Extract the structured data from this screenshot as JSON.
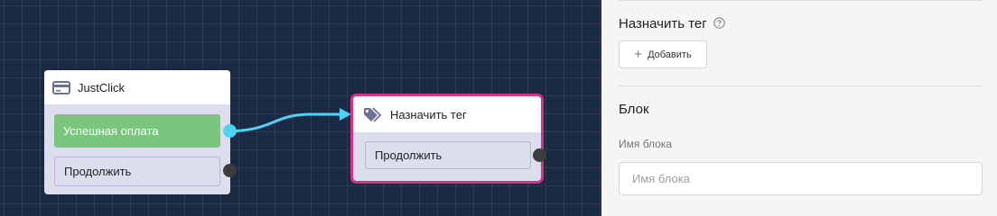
{
  "canvas": {
    "nodes": {
      "justclick": {
        "title": "JustClick",
        "icon": "credit-card-icon",
        "buttons": {
          "success": "Успешная оплата",
          "continue": "Продолжить"
        }
      },
      "assign_tag": {
        "title": "Назначить тег",
        "icon": "tags-icon",
        "buttons": {
          "continue": "Продолжить"
        }
      }
    },
    "colors": {
      "background": "#1b2a44",
      "success": "#7bc67e",
      "connection": "#4fd3f5",
      "selected_border": "#d63384"
    }
  },
  "sidebar": {
    "assign_tag": {
      "title": "Назначить тег",
      "help_icon": "question-circle-icon",
      "add_label": "Добавить"
    },
    "block": {
      "title": "Блок",
      "name_label": "Имя блока",
      "name_placeholder": "Имя блока",
      "name_value": ""
    }
  }
}
